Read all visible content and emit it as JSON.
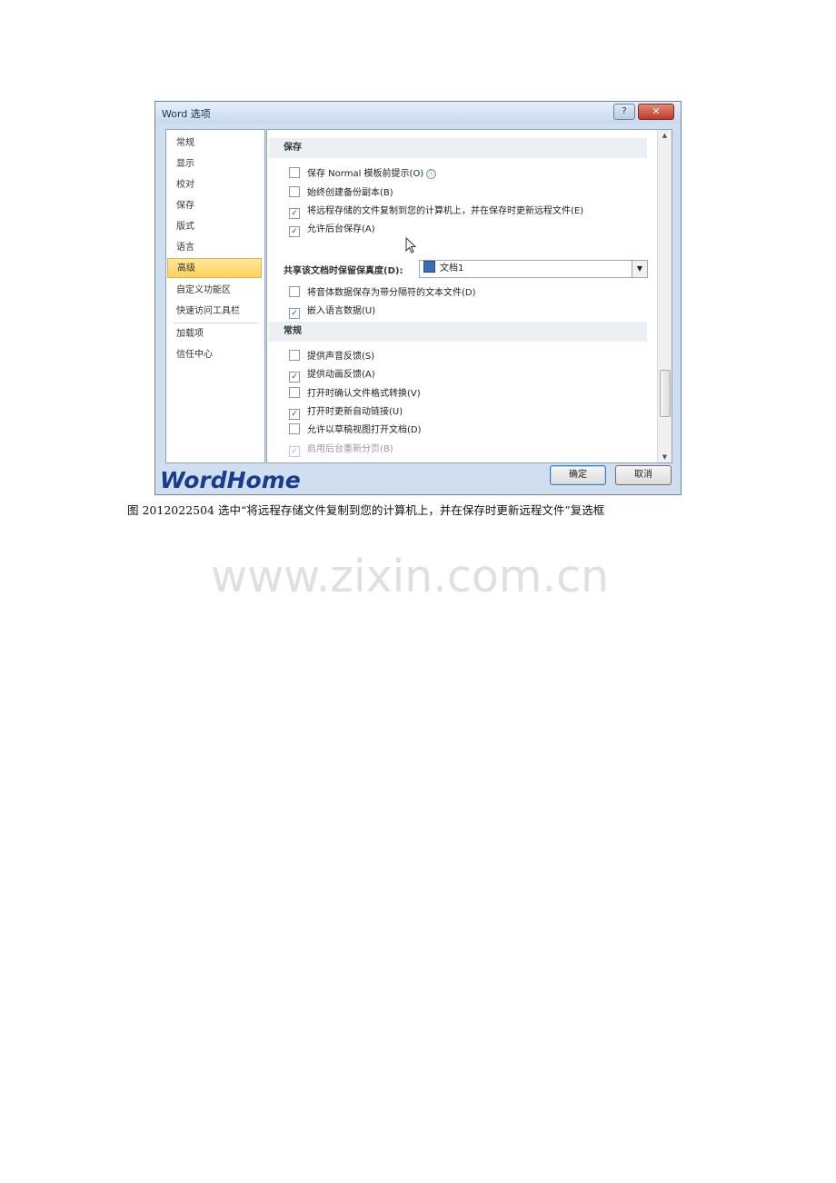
{
  "dialog": {
    "title": "Word 选项",
    "help_glyph": "?",
    "close_glyph": "✕",
    "nav_items": [
      {
        "label": "常规"
      },
      {
        "label": "显示"
      },
      {
        "label": "校对"
      },
      {
        "label": "保存"
      },
      {
        "label": "版式"
      },
      {
        "label": "语言"
      },
      {
        "label": "高级",
        "selected": true
      },
      {
        "label": "自定义功能区"
      },
      {
        "label": "快速访问工具栏"
      },
      {
        "label": "加载项"
      },
      {
        "label": "信任中心"
      }
    ],
    "save_section": {
      "header": "保存",
      "options": [
        {
          "label": "保存 Normal 模板前提示(O)",
          "checked": false,
          "info": true
        },
        {
          "label": "始终创建备份副本(B)",
          "checked": false
        },
        {
          "label": "将远程存储的文件复制到您的计算机上，并在保存时更新远程文件(E)",
          "checked": true
        },
        {
          "label": "允许后台保存(A)",
          "checked": true
        }
      ]
    },
    "fidelity": {
      "label": "共享该文档时保留保真度(D):",
      "selected_document": "文档1",
      "options": [
        {
          "label": "将音体数据保存为带分隔符的文本文件(D)",
          "checked": false
        },
        {
          "label": "嵌入语言数据(U)",
          "checked": true
        }
      ]
    },
    "general_section": {
      "header": "常规",
      "options": [
        {
          "label": "提供声音反馈(S)",
          "checked": false,
          "disabled": false
        },
        {
          "label": "提供动画反馈(A)",
          "checked": true,
          "disabled": false
        },
        {
          "label": "打开时确认文件格式转换(V)",
          "checked": false,
          "disabled": false
        },
        {
          "label": "打开时更新自动链接(U)",
          "checked": true,
          "disabled": false
        },
        {
          "label": "允许以草稿视图打开文档(D)",
          "checked": false,
          "disabled": false
        },
        {
          "label": "启用后台重新分页(B)",
          "checked": true,
          "disabled": true
        }
      ]
    },
    "ok_label": "确定",
    "cancel_label": "取消",
    "logo_text": "WordHome"
  },
  "caption": "图 2012022504 选中“将远程存储文件复制到您的计算机上，并在保存时更新远程文件”复选框",
  "watermark": "www.zixin.com.cn",
  "icons": {
    "info": "ⓘ",
    "check": "✓",
    "dropdown": "▼",
    "scroll_up": "▲",
    "scroll_down": "▼"
  }
}
